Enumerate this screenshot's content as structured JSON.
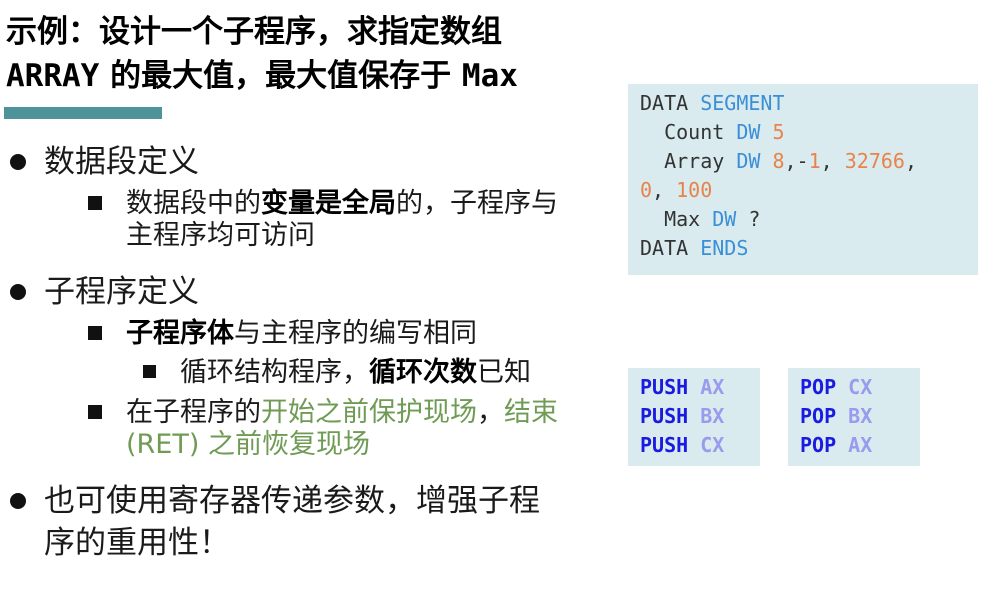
{
  "slide": {
    "title_line1": "示例：设计一个子程序，求指定数组",
    "title_array": "ARRAY",
    "title_mid": " 的最大值，最大值保存于 ",
    "title_max": "Max"
  },
  "bullets": {
    "b1": "数据段定义",
    "b1_sub_pre": "数据段中的",
    "b1_sub_bold": "变量是全局",
    "b1_sub_post": "的，子程序与",
    "b1_sub_line2": "主程序均可访问",
    "b2": "子程序定义",
    "b2_sub1_bold": "子程序体",
    "b2_sub1_post": "与主程序的编写相同",
    "b2_sub1_sub_pre": "循环结构程序，",
    "b2_sub1_sub_bold": "循环次数",
    "b2_sub1_sub_post": "已知",
    "b2_sub2_pre": "在子程序的",
    "b2_sub2_green1": "开始之前保护现场",
    "b2_sub2_comma": "，",
    "b2_sub2_green2": "结束",
    "b2_sub2_line2": "(RET) 之前恢复现场",
    "b3_line1": "也可使用寄存器传递参数，增强子程",
    "b3_line2": "序的重用性！"
  },
  "code_data": {
    "l1_a": "DATA ",
    "l1_b": "SEGMENT",
    "l2_a": "  Count ",
    "l2_b": "DW ",
    "l2_c": "5",
    "l3_a": "  Array ",
    "l3_b": "DW ",
    "l3_c": "8",
    "l3_d": ",-",
    "l3_e": "1",
    "l3_f": ", ",
    "l3_g": "32766",
    "l3_h": ",",
    "l4_a": "0",
    "l4_b": ", ",
    "l4_c": "100",
    "l5_a": "  Max ",
    "l5_b": "DW ",
    "l5_c": "?",
    "l6_a": "DATA ",
    "l6_b": "ENDS"
  },
  "code_push": [
    {
      "op": "PUSH",
      "reg": "AX"
    },
    {
      "op": "PUSH",
      "reg": "BX"
    },
    {
      "op": "PUSH",
      "reg": "CX"
    }
  ],
  "code_pop": [
    {
      "op": "POP",
      "reg": "CX"
    },
    {
      "op": "POP",
      "reg": "BX"
    },
    {
      "op": "POP",
      "reg": "AX"
    }
  ],
  "colors": {
    "title_rule": "#4d9399",
    "code_bg": "#d9ebef",
    "keyword": "#3a8fd6",
    "number": "#e8834a",
    "opcode": "#1a1ae0",
    "register": "#9a9aee",
    "highlight_green": "#6f9b55"
  }
}
